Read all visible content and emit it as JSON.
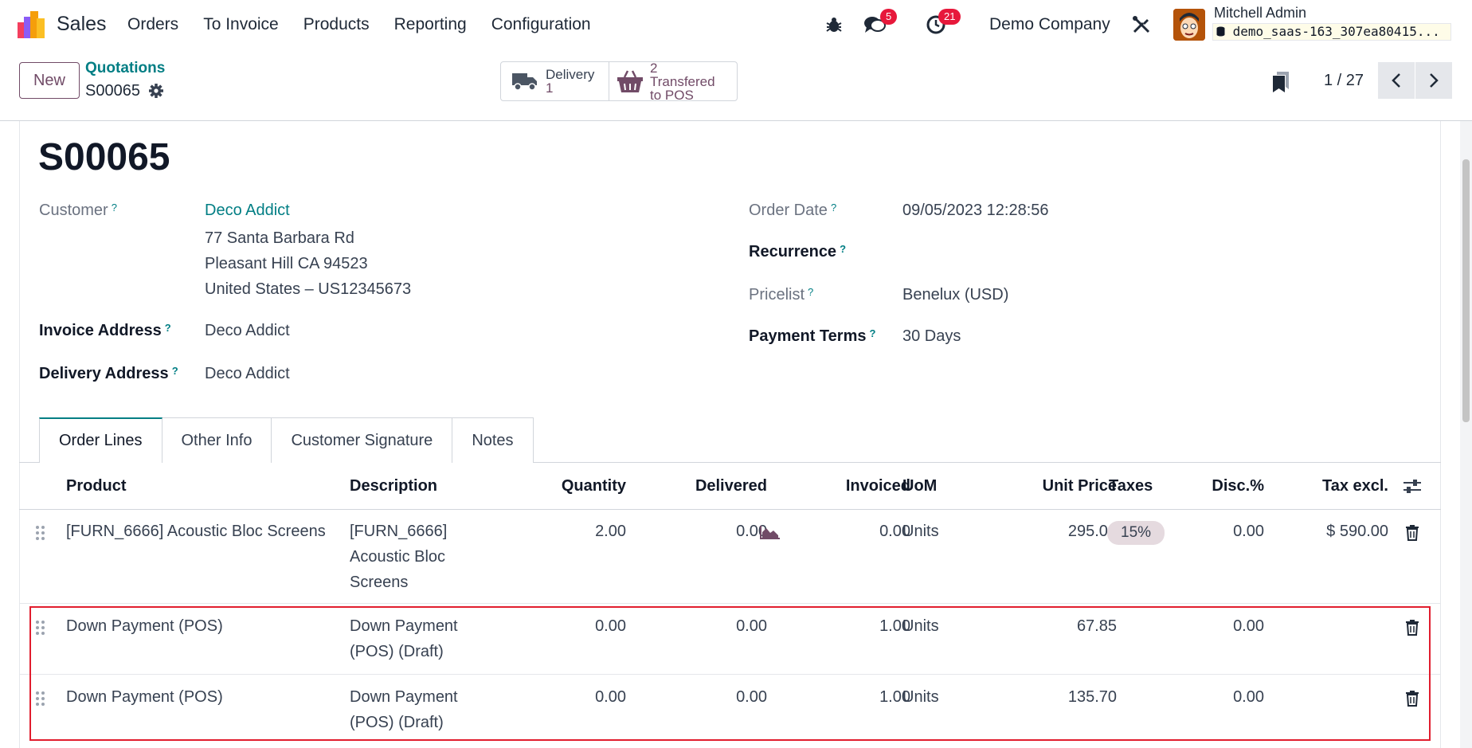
{
  "navbar": {
    "app_name": "Sales",
    "menu": [
      "Orders",
      "To Invoice",
      "Products",
      "Reporting",
      "Configuration"
    ],
    "messages_count": "5",
    "activities_count": "21",
    "company": "Demo Company",
    "user_name": "Mitchell Admin",
    "database": "demo_saas-163_307ea80415..."
  },
  "control_panel": {
    "new_label": "New",
    "breadcrumb_parent": "Quotations",
    "breadcrumb_current": "S00065",
    "smart_delivery_label": "Delivery",
    "smart_delivery_count": "1",
    "smart_pos_count": "2",
    "smart_pos_label_1": "Transfered",
    "smart_pos_label_2": "to POS",
    "pager": "1 / 27"
  },
  "form": {
    "title": "S00065",
    "customer_label": "Customer",
    "customer_name": "Deco Addict",
    "customer_address": [
      "77 Santa Barbara Rd",
      "Pleasant Hill CA 94523",
      "United States – US12345673"
    ],
    "invoice_address_label": "Invoice Address",
    "invoice_address": "Deco Addict",
    "delivery_address_label": "Delivery Address",
    "delivery_address": "Deco Addict",
    "order_date_label": "Order Date",
    "order_date": "09/05/2023 12:28:56",
    "recurrence_label": "Recurrence",
    "pricelist_label": "Pricelist",
    "pricelist": "Benelux (USD)",
    "payment_terms_label": "Payment Terms",
    "payment_terms": "30 Days",
    "help_mark": "?"
  },
  "tabs": [
    "Order Lines",
    "Other Info",
    "Customer Signature",
    "Notes"
  ],
  "table": {
    "headers": {
      "product": "Product",
      "description": "Description",
      "quantity": "Quantity",
      "delivered": "Delivered",
      "invoiced": "Invoiced",
      "uom": "UoM",
      "unit_price": "Unit Price",
      "taxes": "Taxes",
      "discount": "Disc.%",
      "subtotal": "Tax excl."
    },
    "rows": [
      {
        "product": "[FURN_6666] Acoustic Bloc Screens",
        "description": [
          "[FURN_6666]",
          "Acoustic Bloc",
          "Screens"
        ],
        "quantity": "2.00",
        "delivered": "0.00",
        "invoiced": "0.00",
        "uom": "Units",
        "unit_price": "295.00",
        "taxes": "15%",
        "discount": "0.00",
        "subtotal": "$ 590.00"
      },
      {
        "product": "Down Payment (POS)",
        "description": [
          "Down Payment",
          "(POS) (Draft)"
        ],
        "quantity": "0.00",
        "delivered": "0.00",
        "invoiced": "1.00",
        "uom": "Units",
        "unit_price": "67.85",
        "taxes": "",
        "discount": "0.00",
        "subtotal": ""
      },
      {
        "product": "Down Payment (POS)",
        "description": [
          "Down Payment",
          "(POS) (Draft)"
        ],
        "quantity": "0.00",
        "delivered": "0.00",
        "invoiced": "1.00",
        "uom": "Units",
        "unit_price": "135.70",
        "taxes": "",
        "discount": "0.00",
        "subtotal": ""
      }
    ]
  },
  "colors": {
    "brand": "#714b67",
    "link": "#017e84",
    "badge": "#e7183b",
    "highlight": "#e11d2e"
  }
}
